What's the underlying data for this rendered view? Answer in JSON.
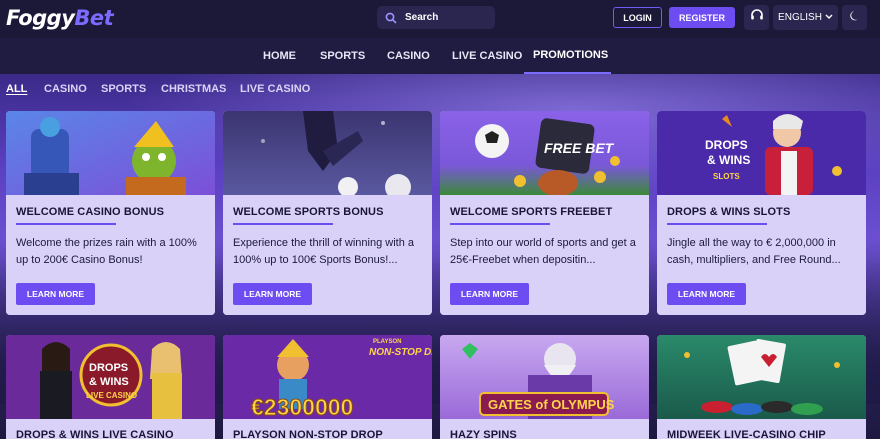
{
  "header": {
    "logo_text_a": "Foggy",
    "logo_text_b": "Bet",
    "search_placeholder": "Search",
    "login_label": "LOGIN",
    "register_label": "REGISTER",
    "language_label": "ENGLISH",
    "support_icon": "headset-icon",
    "theme_icon": "moon-icon",
    "accent_color": "#6d4df2"
  },
  "main_nav": [
    {
      "label": "HOME",
      "active": false
    },
    {
      "label": "SPORTS",
      "active": false
    },
    {
      "label": "CASINO",
      "active": false
    },
    {
      "label": "LIVE CASINO",
      "active": false
    },
    {
      "label": "PROMOTIONS",
      "active": true
    }
  ],
  "filters": [
    {
      "label": "ALL",
      "active": true
    },
    {
      "label": "CASINO",
      "active": false
    },
    {
      "label": "SPORTS",
      "active": false
    },
    {
      "label": "CHRISTMAS",
      "active": false
    },
    {
      "label": "LIVE CASINO",
      "active": false
    }
  ],
  "promotions": [
    {
      "title": "WELCOME CASINO BONUS",
      "description": "Welcome the prizes rain with a 100% up to 200€ Casino Bonus!",
      "cta": "LEARN MORE"
    },
    {
      "title": "WELCOME SPORTS BONUS",
      "description": "Experience the thrill of winning with a 100% up to 100€ Sports Bonus!...",
      "cta": "LEARN MORE"
    },
    {
      "title": "WELCOME SPORTS FREEBET",
      "description": "Step into our world of sports and get a 25€-Freebet when depositin...",
      "cta": "LEARN MORE",
      "image_text": "FREE BET"
    },
    {
      "title": "DROPS & WINS SLOTS",
      "description": "Jingle all the way to € 2,000,000 in cash, multipliers, and Free Round...",
      "cta": "LEARN MORE",
      "image_text_a": "DROPS",
      "image_text_b": "& WINS",
      "image_text_c": "SLOTS"
    },
    {
      "title": "DROPS & WINS LIVE CASINO",
      "image_text_a": "DROPS",
      "image_text_b": "& WINS",
      "image_text_c": "LIVE CASINO"
    },
    {
      "title": "PLAYSON NON-STOP DROP",
      "image_text_a": "€2300000",
      "image_text_b": "NON-STOP DROP",
      "image_text_c": "PLAYSON"
    },
    {
      "title": "HAZY SPINS",
      "image_text_a": "GATES of OLYMPUS"
    },
    {
      "title": "MIDWEEK LIVE-CASINO CHIP"
    }
  ]
}
